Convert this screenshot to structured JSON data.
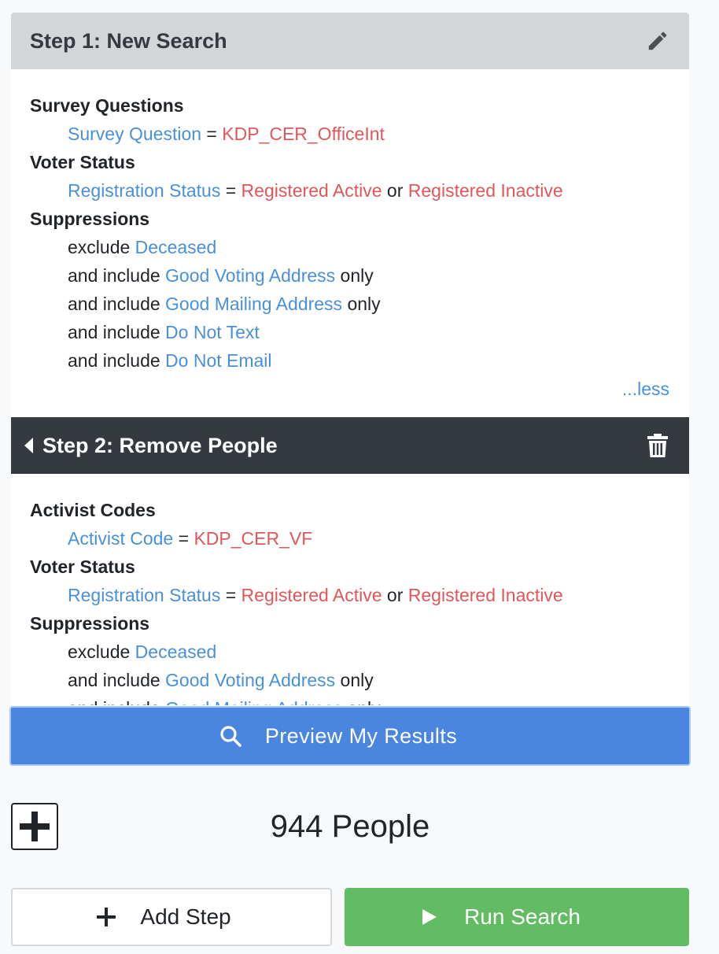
{
  "step1": {
    "title": "Step 1: New Search",
    "edit_icon": "pencil-icon",
    "sections": [
      {
        "title": "Survey Questions",
        "lines": [
          {
            "field": "Survey Question",
            "op": " = ",
            "values": [
              "KDP_CER_OfficeInt"
            ]
          }
        ]
      },
      {
        "title": "Voter Status",
        "lines": [
          {
            "field": "Registration Status",
            "op": " = ",
            "values": [
              "Registered Active",
              "Registered Inactive"
            ],
            "joiner": " or "
          }
        ]
      },
      {
        "title": "Suppressions",
        "lines": [
          {
            "prefix": "exclude ",
            "item": "Deceased",
            "suffix": ""
          },
          {
            "prefix": "and include ",
            "item": "Good Voting Address",
            "suffix": " only"
          },
          {
            "prefix": "and include ",
            "item": "Good Mailing Address",
            "suffix": " only"
          },
          {
            "prefix": "and include ",
            "item": "Do Not Text",
            "suffix": ""
          },
          {
            "prefix": "and include ",
            "item": "Do Not Email",
            "suffix": ""
          }
        ]
      }
    ],
    "less_link": "...less"
  },
  "step2": {
    "title": "Step 2: Remove People",
    "delete_icon": "trash-icon",
    "sections": [
      {
        "title": "Activist Codes",
        "lines": [
          {
            "field": "Activist Code",
            "op": " = ",
            "values": [
              "KDP_CER_VF"
            ]
          }
        ]
      },
      {
        "title": "Voter Status",
        "lines": [
          {
            "field": "Registration Status",
            "op": " = ",
            "values": [
              "Registered Active",
              "Registered Inactive"
            ],
            "joiner": " or "
          }
        ]
      },
      {
        "title": "Suppressions",
        "lines": [
          {
            "prefix": "exclude ",
            "item": "Deceased",
            "suffix": ""
          },
          {
            "prefix": "and include ",
            "item": "Good Voting Address",
            "suffix": " only"
          },
          {
            "prefix": "and include ",
            "item": "Good Mailing Address",
            "suffix": " only"
          }
        ]
      }
    ]
  },
  "preview_button": {
    "label": "Preview My Results",
    "icon": "search-icon"
  },
  "result_count": "944 People",
  "add_step_button": {
    "label": "Add Step",
    "icon": "plus-icon"
  },
  "run_search_button": {
    "label": "Run Search",
    "icon": "play-icon"
  },
  "colors": {
    "accent_blue": "#4a90d9",
    "value_red": "#e15759",
    "preview_blue": "#4a86e0",
    "run_green": "#62bc63",
    "dark_header": "#343a40"
  }
}
